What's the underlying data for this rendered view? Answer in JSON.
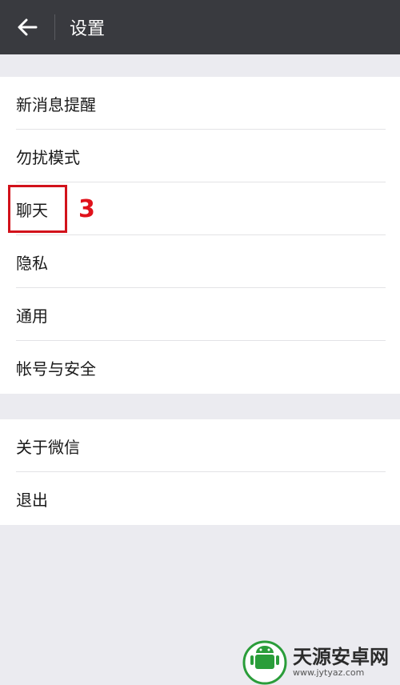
{
  "header": {
    "title": "设置",
    "back_icon": "arrow-left-icon"
  },
  "groups": [
    {
      "items": [
        {
          "label": "新消息提醒"
        },
        {
          "label": "勿扰模式"
        },
        {
          "label": "聊天"
        },
        {
          "label": "隐私"
        },
        {
          "label": "通用"
        },
        {
          "label": "帐号与安全"
        }
      ]
    },
    {
      "items": [
        {
          "label": "关于微信"
        },
        {
          "label": "退出"
        }
      ]
    }
  ],
  "annotation": {
    "step_number": "3",
    "color": "#d2121b"
  },
  "watermark": {
    "title": "天源安卓网",
    "url": "www.jytyaz.com"
  },
  "colors": {
    "topbar": "#393a3f",
    "background": "#ebebf0",
    "logo_green": "#2a9d3a"
  }
}
